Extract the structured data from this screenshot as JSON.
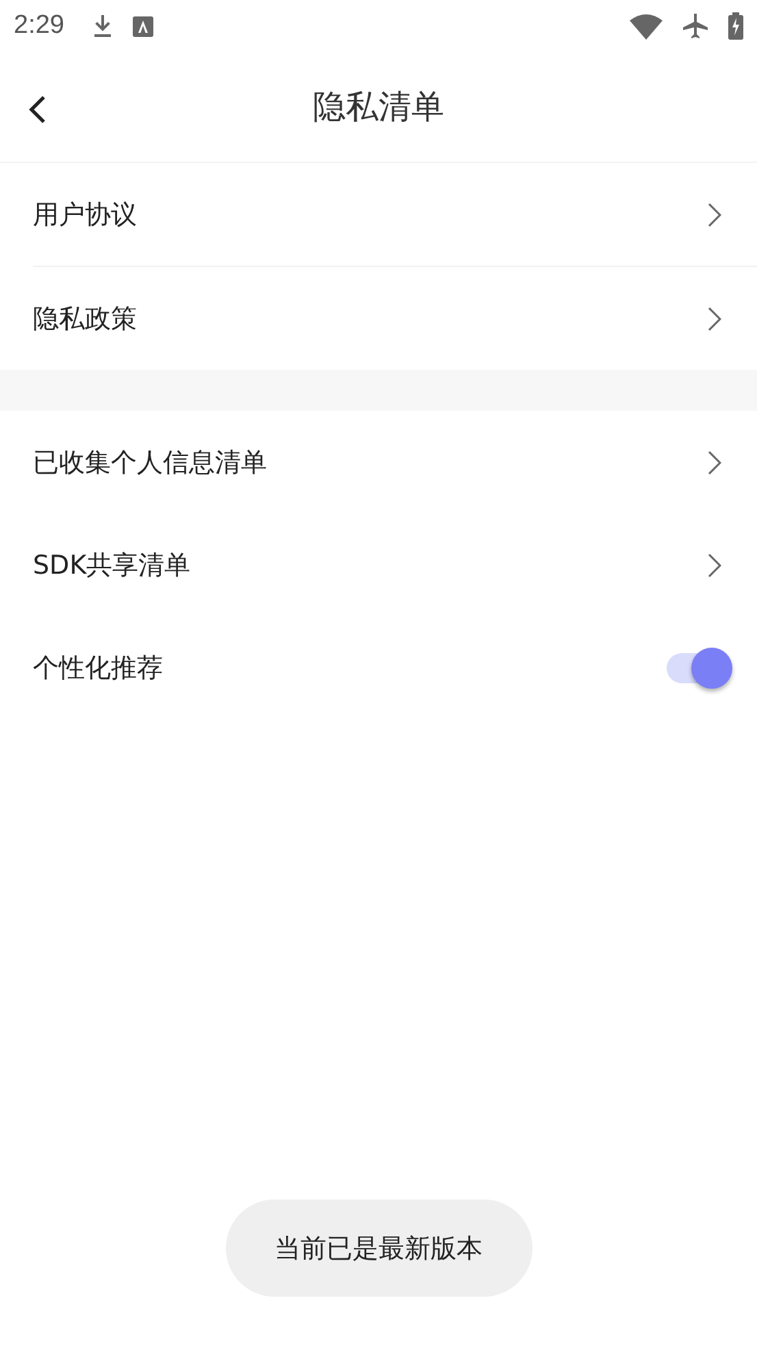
{
  "status_bar": {
    "time": "2:29"
  },
  "header": {
    "title": "隐私清单"
  },
  "groups": [
    {
      "items": [
        {
          "kind": "link",
          "label": "用户协议"
        },
        {
          "kind": "link",
          "label": "隐私政策"
        }
      ]
    },
    {
      "items": [
        {
          "kind": "link",
          "label": "已收集个人信息清单"
        },
        {
          "kind": "link",
          "label": "SDK共享清单"
        },
        {
          "kind": "toggle",
          "label": "个性化推荐",
          "on": true
        }
      ]
    }
  ],
  "toast": {
    "text": "当前已是最新版本"
  }
}
